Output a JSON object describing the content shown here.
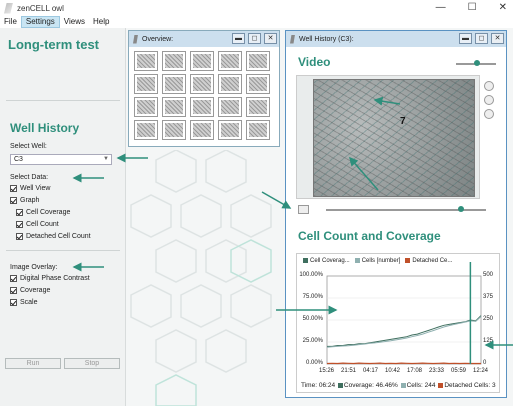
{
  "app": {
    "title": "zenCELL owl",
    "minimize": "—",
    "maximize": "☐",
    "close": "✕"
  },
  "menu": {
    "file": "File",
    "settings": "Settings",
    "views": "Views",
    "help": "Help"
  },
  "left": {
    "experiment_title": "Long-term test",
    "well_history_title": "Well History",
    "select_well_label": "Select Well:",
    "selected_well": "C3",
    "select_data_label": "Select Data:",
    "data_options": [
      {
        "label": "Well View",
        "checked": true
      },
      {
        "label": "Graph",
        "checked": true
      },
      {
        "label": "Cell Coverage",
        "checked": true
      },
      {
        "label": "Cell Count",
        "checked": true
      },
      {
        "label": "Detached Cell Count",
        "checked": true
      }
    ],
    "image_overlay_label": "Image Overlay:",
    "overlay_options": [
      {
        "label": "Digital Phase Contrast",
        "checked": true
      },
      {
        "label": "Coverage",
        "checked": true
      },
      {
        "label": "Scale",
        "checked": true
      }
    ],
    "run_label": "Run",
    "stop_label": "Stop"
  },
  "overview": {
    "title": "Overview:"
  },
  "well_history": {
    "title": "Well History (C3):",
    "video_title": "Video",
    "video_marker": "7",
    "chart_title": "Cell Count and Coverage"
  },
  "chart_data": {
    "type": "line",
    "legend": [
      "Cell Coverag...",
      "Cells [number]",
      "Detached Ce..."
    ],
    "colors": {
      "coverage": "#3f6f5f",
      "cells": "#8fb0b0",
      "detached": "#c0502a",
      "accent": "#2f8f7c",
      "cursor": "#2f8f7c"
    },
    "y_left_ticks": [
      "100.00%",
      "75.00%",
      "50.00%",
      "25.00%",
      "0.00%"
    ],
    "y_right_ticks": [
      "500",
      "375",
      "250",
      "125",
      "0"
    ],
    "ylim_left": [
      0,
      100
    ],
    "ylim_right": [
      0,
      500
    ],
    "x_ticks": [
      "15:26",
      "21:51",
      "04:17",
      "10:42",
      "17:08",
      "23:33",
      "05:59",
      "12:24"
    ],
    "series": [
      {
        "name": "Cell Coverag...",
        "axis": "left",
        "values": [
          20,
          20,
          21,
          21,
          22,
          22,
          23,
          23,
          24,
          25,
          26,
          27,
          28,
          29,
          30,
          31,
          33,
          34,
          36,
          38,
          40,
          42,
          44,
          45,
          46,
          47,
          48,
          50,
          49,
          55
        ]
      },
      {
        "name": "Cells [number]",
        "axis": "right",
        "values": [
          95,
          98,
          100,
          102,
          104,
          107,
          110,
          113,
          117,
          120,
          124,
          128,
          132,
          137,
          142,
          148,
          155,
          162,
          170,
          180,
          190,
          200,
          210,
          218,
          225,
          232,
          238,
          245,
          242,
          270
        ]
      },
      {
        "name": "Detached Ce...",
        "axis": "right",
        "values": [
          3,
          4,
          3,
          5,
          4,
          3,
          5,
          4,
          3,
          4,
          5,
          3,
          4,
          3,
          5,
          4,
          3,
          4,
          5,
          4,
          3,
          4,
          5,
          3,
          4,
          3,
          4,
          3,
          3,
          3
        ]
      }
    ],
    "cursor_index": 27,
    "status": {
      "time_label": "Time:",
      "time": "06:24",
      "coverage_label": "Coverage:",
      "coverage": "46.46%",
      "cells_label": "Cells:",
      "cells": "244",
      "detached_label": "Detached Cells:",
      "detached": "3"
    }
  }
}
